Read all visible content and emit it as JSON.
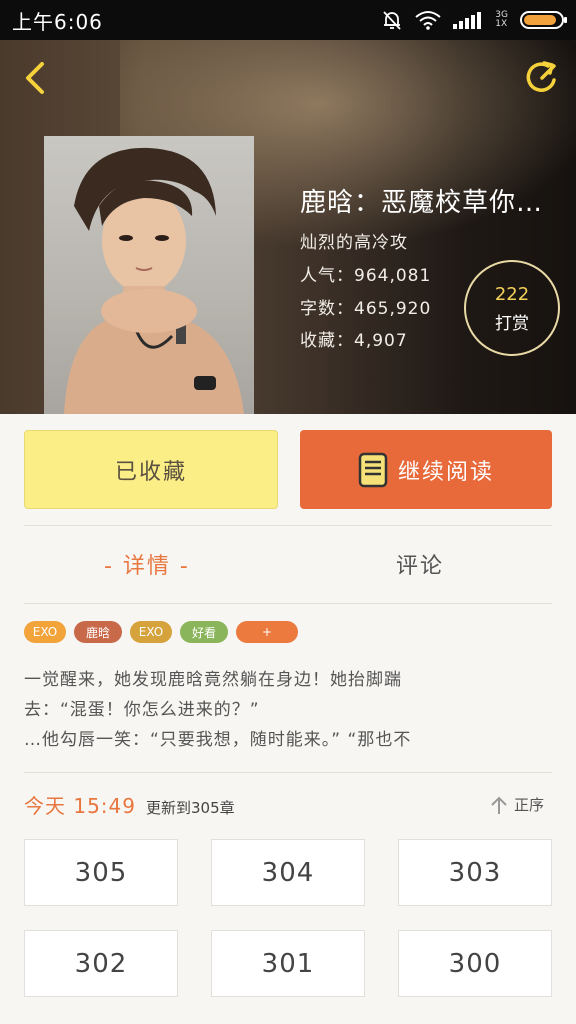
{
  "status_bar": {
    "time": "上午6:06",
    "network_type": "3G",
    "network_sim": "1X",
    "battery_level": 0.9
  },
  "book": {
    "title": "鹿晗：恶魔校草你…",
    "author": "灿烈的高冷攻",
    "popularity": "人气：964,081",
    "word_count": "字数：465,920",
    "favorites": "收藏：4,907"
  },
  "reward": {
    "count": "222",
    "label": "打赏"
  },
  "actions": {
    "collected_label": "已收藏",
    "continue_label": "继续阅读"
  },
  "tabs": {
    "details": "- 详情 -",
    "comments": "评论"
  },
  "tags": [
    {
      "label": "EXO",
      "color": "#f2a33a"
    },
    {
      "label": "鹿晗",
      "color": "#c8694a"
    },
    {
      "label": "EXO",
      "color": "#d6a23b"
    },
    {
      "label": "好看",
      "color": "#8ab55a"
    },
    {
      "label": "+",
      "color": "#ec7a3f"
    }
  ],
  "description": [
    "一觉醒来，她发现鹿晗竟然躺在身边！她抬脚踹",
    "去：“混蛋！你怎么进来的？”",
    "…他勾唇一笑：“只要我想，随时能来。” “那也不"
  ],
  "update": {
    "time": "今天 15:49",
    "text": "更新到305章"
  },
  "sort_label": "正序",
  "chapters": [
    "305",
    "304",
    "303",
    "302",
    "301",
    "300"
  ],
  "colors": {
    "accent": "#e8763f",
    "collected_bg": "#fbee86",
    "read_bg": "#e86a3b",
    "reward_text": "#f3d15a"
  }
}
